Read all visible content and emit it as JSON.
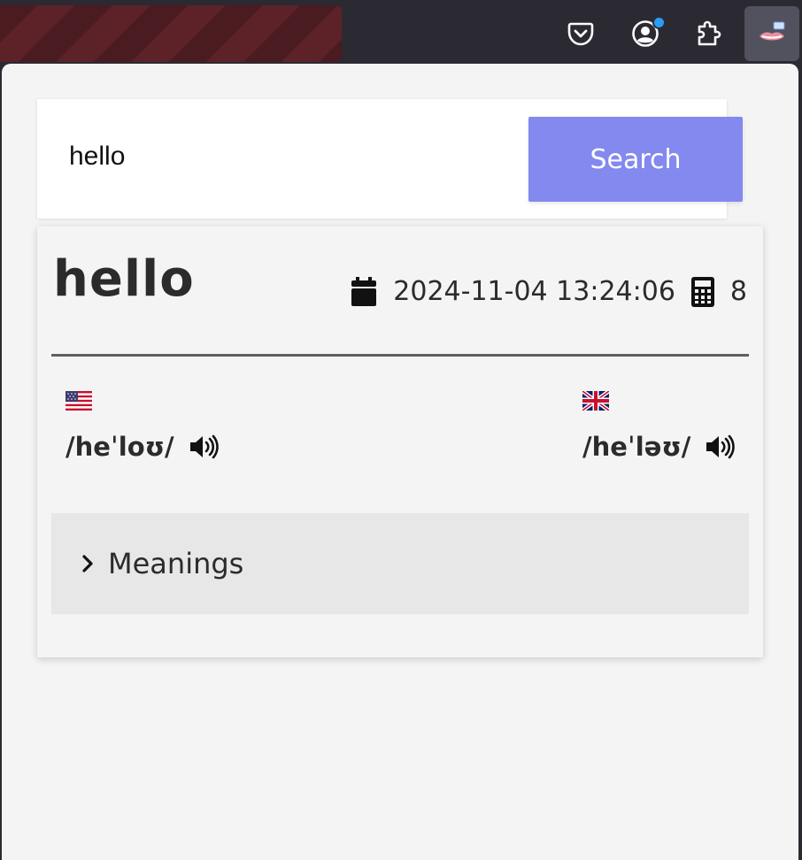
{
  "toolbar": {
    "buttons": [
      {
        "name": "pocket-icon"
      },
      {
        "name": "account-icon",
        "has_notification": true
      },
      {
        "name": "extensions-icon"
      },
      {
        "name": "dictionary-extension-icon",
        "active": true
      }
    ]
  },
  "search": {
    "value": "hello",
    "button_label": "Search"
  },
  "result": {
    "word": "hello",
    "timestamp": "2024-11-04 13:24:06",
    "count": "8",
    "pronunciations": [
      {
        "region": "US",
        "flag_icon": "us-flag-icon",
        "ipa": "/heˈloʊ/"
      },
      {
        "region": "UK",
        "flag_icon": "uk-flag-icon",
        "ipa": "/heˈləʊ/"
      }
    ],
    "meanings_label": "Meanings"
  },
  "colors": {
    "accent": "#8389ee",
    "text": "#2b2b2b",
    "panel": "#f4f4f4",
    "toolbar": "#2b2a33",
    "notification": "#2a9df4"
  }
}
